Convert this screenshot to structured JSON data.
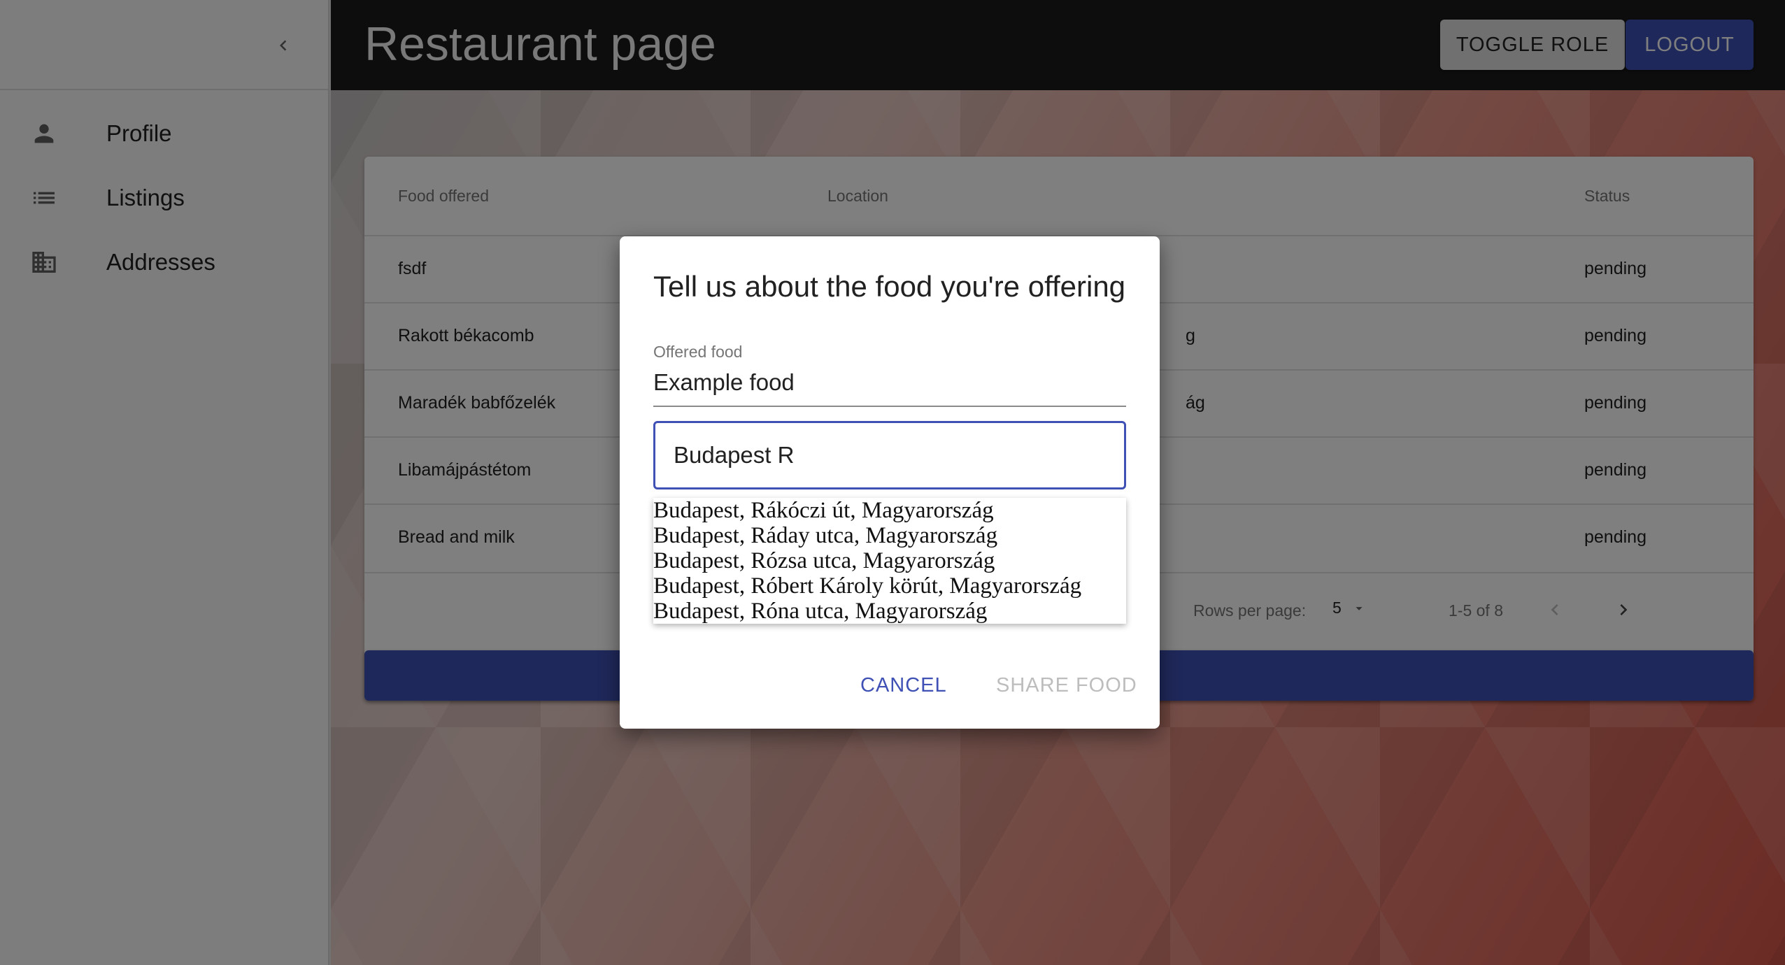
{
  "sidebar": {
    "collapse_icon": "chevron-left-icon",
    "items": [
      {
        "label": "Profile",
        "icon": "person-icon"
      },
      {
        "label": "Listings",
        "icon": "list-icon"
      },
      {
        "label": "Addresses",
        "icon": "building-icon"
      }
    ]
  },
  "header": {
    "title": "Restaurant page",
    "toggle_role_label": "TOGGLE ROLE",
    "logout_label": "LOGOUT"
  },
  "table": {
    "columns": [
      "Food offered",
      "Location",
      "Status"
    ],
    "rows": [
      {
        "food": "fsdf",
        "location": "",
        "status": "pending"
      },
      {
        "food": "Rakott békacomb",
        "location": "g",
        "status": "pending"
      },
      {
        "food": "Maradék babfőzelék",
        "location": "ág",
        "status": "pending"
      },
      {
        "food": "Libamájpástétom",
        "location": "",
        "status": "pending"
      },
      {
        "food": "Bread and milk",
        "location": "",
        "status": "pending"
      }
    ],
    "pagination": {
      "rows_per_page_label": "Rows per page:",
      "rows_per_page_value": "5",
      "range": "1-5 of 8"
    }
  },
  "dialog": {
    "title": "Tell us about the food you're offering",
    "food_field": {
      "label": "Offered food",
      "value": "Example food"
    },
    "address_field": {
      "value": "Budapest R"
    },
    "suggestions": [
      "Budapest, Rákóczi út, Magyarország",
      "Budapest, Ráday utca, Magyarország",
      "Budapest, Rózsa utca, Magyarország",
      "Budapest, Róbert Károly körút, Magyarország",
      "Budapest, Róna utca, Magyarország"
    ],
    "cancel_label": "CANCEL",
    "share_label": "SHARE FOOD"
  },
  "colors": {
    "primary": "#3f51b5",
    "topbar": "#1c1a1a",
    "disabled_text": "#bdbdbd"
  }
}
